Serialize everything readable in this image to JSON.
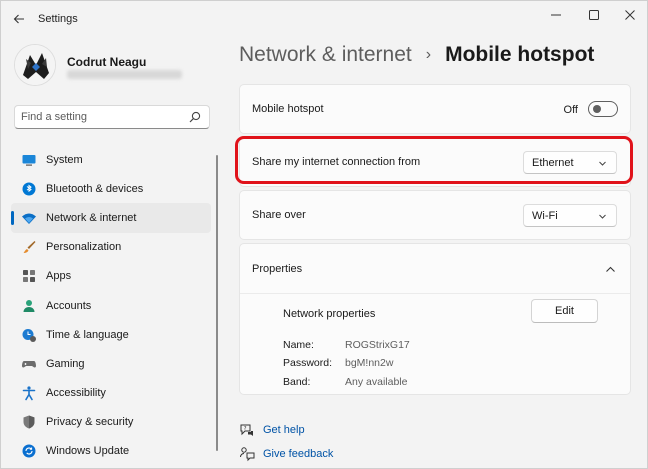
{
  "window": {
    "title": "Settings"
  },
  "profile": {
    "name": "Codrut Neagu"
  },
  "search": {
    "placeholder": "Find a setting"
  },
  "sidebar": {
    "items": [
      {
        "label": "System",
        "icon": "monitor-icon",
        "active": false
      },
      {
        "label": "Bluetooth & devices",
        "icon": "bluetooth-icon",
        "active": false
      },
      {
        "label": "Network & internet",
        "icon": "wifi-icon",
        "active": true
      },
      {
        "label": "Personalization",
        "icon": "brush-icon",
        "active": false
      },
      {
        "label": "Apps",
        "icon": "apps-icon",
        "active": false
      },
      {
        "label": "Accounts",
        "icon": "person-icon",
        "active": false
      },
      {
        "label": "Time & language",
        "icon": "clock-globe-icon",
        "active": false
      },
      {
        "label": "Gaming",
        "icon": "gamepad-icon",
        "active": false
      },
      {
        "label": "Accessibility",
        "icon": "accessibility-icon",
        "active": false
      },
      {
        "label": "Privacy & security",
        "icon": "shield-icon",
        "active": false
      },
      {
        "label": "Windows Update",
        "icon": "update-icon",
        "active": false
      }
    ]
  },
  "header": {
    "parent": "Network & internet",
    "separator": "›",
    "current": "Mobile hotspot"
  },
  "hotspot": {
    "label": "Mobile hotspot",
    "state_label": "Off",
    "enabled": false
  },
  "share_from": {
    "label": "Share my internet connection from",
    "selected": "Ethernet"
  },
  "share_over": {
    "label": "Share over",
    "selected": "Wi-Fi"
  },
  "properties": {
    "title": "Properties",
    "network_properties_label": "Network properties",
    "edit_label": "Edit",
    "rows": [
      {
        "key": "Name:",
        "value": "ROGStrixG17"
      },
      {
        "key": "Password:",
        "value": "bgM!nn2w"
      },
      {
        "key": "Band:",
        "value": "Any available"
      }
    ]
  },
  "links": {
    "help": "Get help",
    "feedback": "Give feedback"
  },
  "colors": {
    "accent": "#0067c0",
    "highlight": "#e0121a",
    "link": "#0053a6"
  }
}
